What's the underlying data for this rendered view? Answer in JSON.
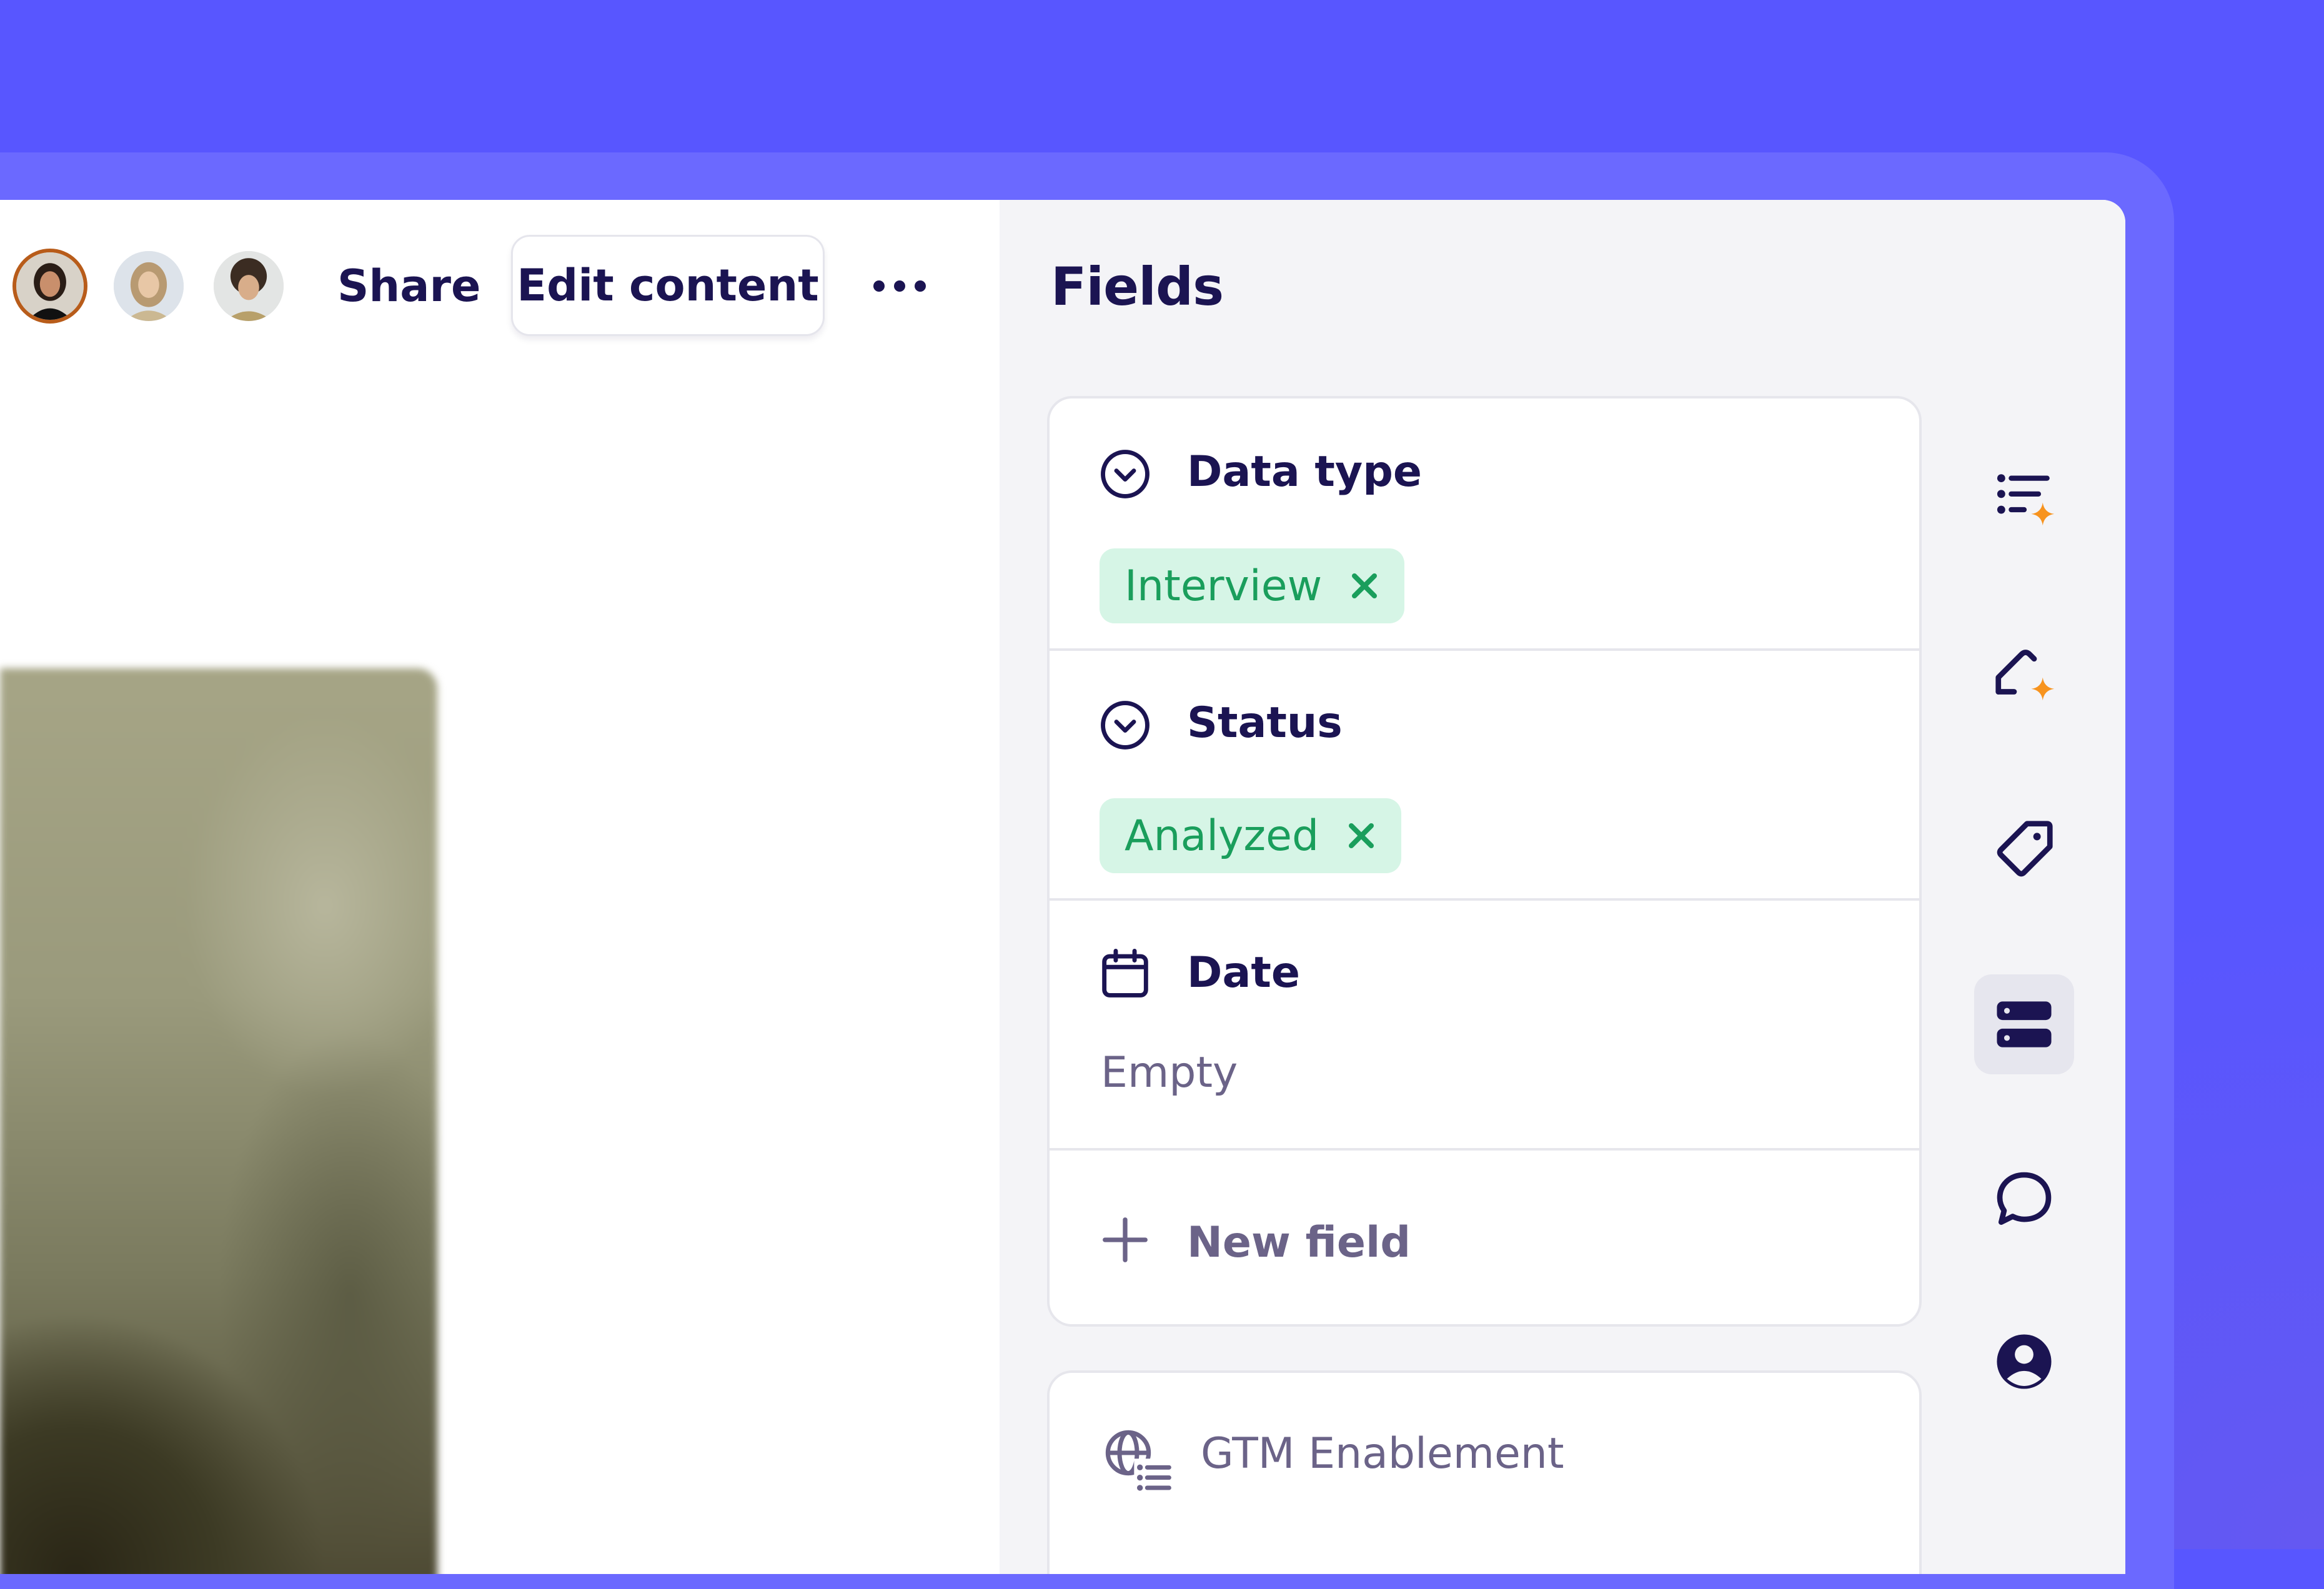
{
  "colors": {
    "background": "#5856ff",
    "accent_star": "#f7931e",
    "chip_bg": "#d6f5e6",
    "chip_text": "#1a9e5c",
    "text_primary": "#1b1452",
    "text_muted": "#6b6388"
  },
  "header": {
    "avatars": [
      {
        "icon": "avatar-photo-person-1"
      },
      {
        "icon": "avatar-photo-person-2"
      },
      {
        "icon": "avatar-photo-person-3"
      }
    ],
    "share_label": "Share",
    "edit_content_label": "Edit content",
    "more_icon": "more-horizontal-icon"
  },
  "fields_panel": {
    "title": "Fields",
    "fields": [
      {
        "label": "Data type",
        "icon": "chevron-circle-icon",
        "chip": "Interview"
      },
      {
        "label": "Status",
        "icon": "chevron-circle-icon",
        "chip": "Analyzed"
      },
      {
        "label": "Date",
        "icon": "calendar-icon",
        "value": "Empty"
      }
    ],
    "new_field_label": "New field",
    "group": {
      "label": "GTM Enablement",
      "icon": "globe-list-icon"
    }
  },
  "rail": {
    "items": [
      {
        "icon": "ai-list-icon",
        "active": false
      },
      {
        "icon": "ai-highlight-icon",
        "active": false
      },
      {
        "icon": "tag-icon",
        "active": false
      },
      {
        "icon": "fields-icon",
        "active": true
      },
      {
        "icon": "comment-icon",
        "active": false
      },
      {
        "icon": "user-icon",
        "active": false
      }
    ]
  }
}
